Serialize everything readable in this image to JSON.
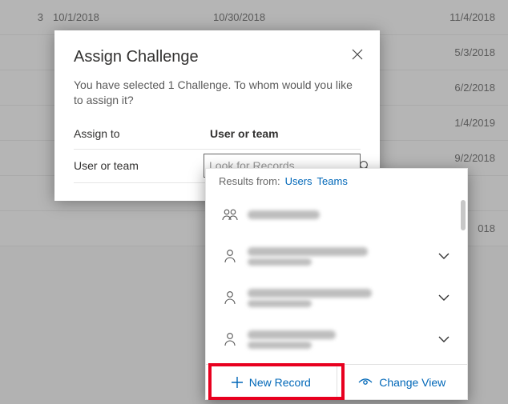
{
  "grid": {
    "rows": [
      {
        "idx": "3",
        "d1": "10/1/2018",
        "d2": "10/30/2018",
        "d3": "11/4/2018"
      },
      {
        "idx": "",
        "d1": "",
        "d2": "",
        "d3": "5/3/2018"
      },
      {
        "idx": "",
        "d1": "",
        "d2": "",
        "d3": "6/2/2018"
      },
      {
        "idx": "",
        "d1": "",
        "d2": "",
        "d3": "1/4/2019"
      },
      {
        "idx": "",
        "d1": "",
        "d2": "",
        "d3": "9/2/2018"
      },
      {
        "idx": "",
        "d1": "",
        "d2": "",
        "d3": ""
      },
      {
        "idx": "",
        "d1": "",
        "d2": "",
        "d3": "018"
      }
    ]
  },
  "dialog": {
    "title": "Assign Challenge",
    "description": "You have selected 1 Challenge. To whom would you like to assign it?",
    "assign_to_label": "Assign to",
    "assign_to_value": "User or team",
    "user_or_team_label": "User or team",
    "lookup_placeholder": "Look for Records"
  },
  "flyout": {
    "results_from_label": "Results from:",
    "tab_users": "Users",
    "tab_teams": "Teams",
    "new_record_label": "New Record",
    "change_view_label": "Change View"
  }
}
